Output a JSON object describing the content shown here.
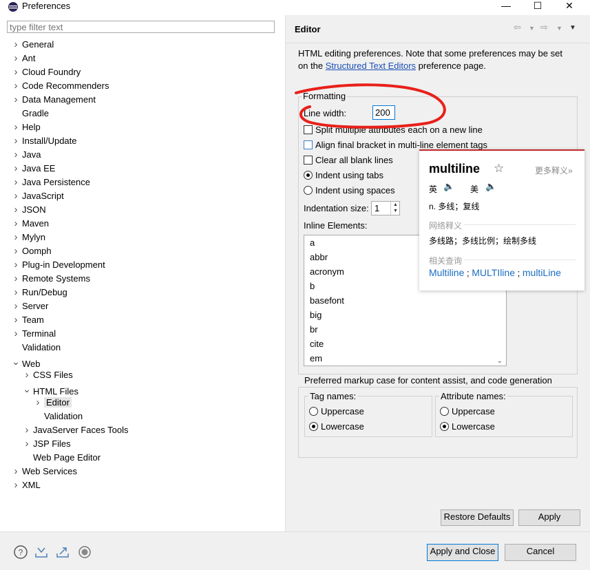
{
  "window": {
    "title": "Preferences",
    "minimize": "—",
    "maximize": "☐",
    "close": "✕"
  },
  "filter": {
    "placeholder": "type filter text"
  },
  "tree": [
    {
      "label": "General",
      "level": 0,
      "chevron": "right"
    },
    {
      "label": "Ant",
      "level": 0,
      "chevron": "right"
    },
    {
      "label": "Cloud Foundry",
      "level": 0,
      "chevron": "right"
    },
    {
      "label": "Code Recommenders",
      "level": 0,
      "chevron": "right"
    },
    {
      "label": "Data Management",
      "level": 0,
      "chevron": "right"
    },
    {
      "label": "Gradle",
      "level": 0,
      "chevron": "none"
    },
    {
      "label": "Help",
      "level": 0,
      "chevron": "right"
    },
    {
      "label": "Install/Update",
      "level": 0,
      "chevron": "right"
    },
    {
      "label": "Java",
      "level": 0,
      "chevron": "right"
    },
    {
      "label": "Java EE",
      "level": 0,
      "chevron": "right"
    },
    {
      "label": "Java Persistence",
      "level": 0,
      "chevron": "right"
    },
    {
      "label": "JavaScript",
      "level": 0,
      "chevron": "right"
    },
    {
      "label": "JSON",
      "level": 0,
      "chevron": "right"
    },
    {
      "label": "Maven",
      "level": 0,
      "chevron": "right"
    },
    {
      "label": "Mylyn",
      "level": 0,
      "chevron": "right"
    },
    {
      "label": "Oomph",
      "level": 0,
      "chevron": "right"
    },
    {
      "label": "Plug-in Development",
      "level": 0,
      "chevron": "right"
    },
    {
      "label": "Remote Systems",
      "level": 0,
      "chevron": "right"
    },
    {
      "label": "Run/Debug",
      "level": 0,
      "chevron": "right"
    },
    {
      "label": "Server",
      "level": 0,
      "chevron": "right"
    },
    {
      "label": "Team",
      "level": 0,
      "chevron": "right"
    },
    {
      "label": "Terminal",
      "level": 0,
      "chevron": "right"
    },
    {
      "label": "Validation",
      "level": 0,
      "chevron": "none"
    },
    {
      "label": "Web",
      "level": 0,
      "chevron": "down"
    },
    {
      "label": "CSS Files",
      "level": 1,
      "chevron": "right"
    },
    {
      "label": "HTML Files",
      "level": 1,
      "chevron": "down"
    },
    {
      "label": "Editor",
      "level": 2,
      "chevron": "right",
      "selected": true
    },
    {
      "label": "Validation",
      "level": 2,
      "chevron": "none"
    },
    {
      "label": "JavaServer Faces Tools",
      "level": 1,
      "chevron": "right"
    },
    {
      "label": "JSP Files",
      "level": 1,
      "chevron": "right"
    },
    {
      "label": "Web Page Editor",
      "level": 1,
      "chevron": "none"
    },
    {
      "label": "Web Services",
      "level": 0,
      "chevron": "right"
    },
    {
      "label": "XML",
      "level": 0,
      "chevron": "right"
    }
  ],
  "editor": {
    "title": "Editor",
    "desc_line1": "HTML editing preferences.  Note that some preferences may be set",
    "desc_pre": "on the ",
    "desc_link": "Structured Text Editors",
    "desc_post": " preference page.",
    "formatting": {
      "label": "Formatting",
      "line_width_label": "Line width:",
      "line_width_value": "200",
      "split_attributes": "Split multiple attributes each on a new line",
      "align_bracket": "Align final bracket in multi-line element tags",
      "clear_blank": "Clear all blank lines",
      "indent_tabs": "Indent using tabs",
      "indent_spaces": "Indent using spaces",
      "indentation_size_label": "Indentation size:",
      "indentation_size_value": "1",
      "inline_label": "Inline Elements:",
      "inline_elements": [
        "a",
        "abbr",
        "acronym",
        "b",
        "basefont",
        "big",
        "br",
        "cite",
        "em"
      ]
    },
    "markup": {
      "label": "Preferred markup case for content assist, and code generation",
      "tag_label": "Tag names:",
      "attr_label": "Attribute names:",
      "uppercase": "Uppercase",
      "lowercase": "Lowercase"
    },
    "restore_defaults": "Restore Defaults",
    "apply": "Apply"
  },
  "footer": {
    "apply_close": "Apply and Close",
    "cancel": "Cancel"
  },
  "dict": {
    "word": "multiline",
    "more": "更多释义»",
    "uk": "英",
    "us": "美",
    "definition": "n. 多线；复线",
    "web_heading": "网络释义",
    "web_meaning": "多线路；多线比例；绘制多线",
    "related_heading": "相关查询",
    "related": [
      "Multiline",
      "MULTIline",
      "multiLine"
    ],
    "sep": ";"
  },
  "colors": {
    "annotation_red": "#e8201a",
    "link_blue": "#1a4fb5",
    "dict_accent": "#c2292a"
  }
}
